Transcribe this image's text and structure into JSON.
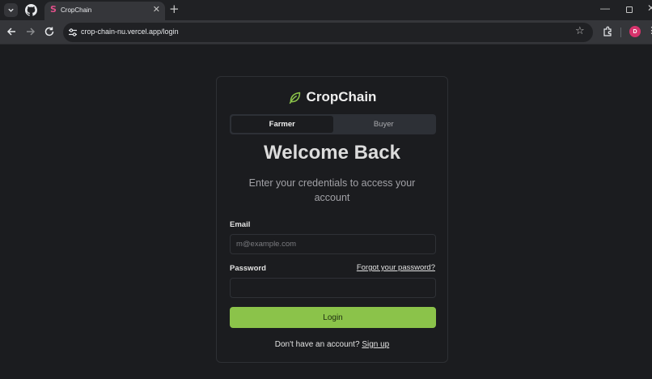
{
  "browser": {
    "tab_title": "CropChain",
    "tab_favicon": "S",
    "url": "crop-chain-nu.vercel.app/login",
    "avatar_initial": "D"
  },
  "page": {
    "brand_name": "CropChain",
    "role_tabs": [
      "Farmer",
      "Buyer"
    ],
    "heading": "Welcome Back",
    "subheading": "Enter your credentials to access your account",
    "email_label": "Email",
    "email_placeholder": "m@example.com",
    "password_label": "Password",
    "forgot_password": "Forgot your password?",
    "login_button": "Login",
    "signup_prompt": "Don't have an account?",
    "signup_link": "Sign up"
  },
  "colors": {
    "accent": "#8bc34a",
    "background": "#1b1c1f"
  }
}
